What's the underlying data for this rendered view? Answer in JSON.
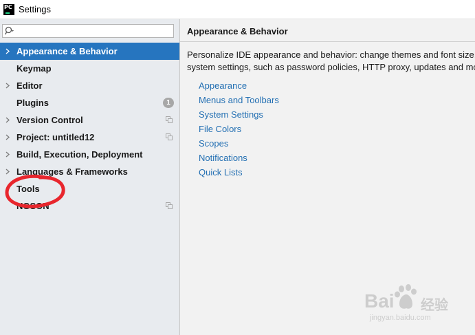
{
  "window": {
    "app_icon_text": "PC",
    "title": "Settings"
  },
  "search": {
    "value": "",
    "placeholder": ""
  },
  "sidebar": {
    "items": [
      {
        "label": "Appearance & Behavior",
        "expandable": true,
        "selected": true
      },
      {
        "label": "Keymap",
        "expandable": false
      },
      {
        "label": "Editor",
        "expandable": true
      },
      {
        "label": "Plugins",
        "expandable": false,
        "badge": "1"
      },
      {
        "label": "Version Control",
        "expandable": true,
        "copy_icon": true
      },
      {
        "label": "Project: untitled12",
        "expandable": true,
        "copy_icon": true
      },
      {
        "label": "Build, Execution, Deployment",
        "expandable": true
      },
      {
        "label": "Languages & Frameworks",
        "expandable": true
      },
      {
        "label": "Tools",
        "expandable": false
      },
      {
        "label": "NGSON",
        "expandable": false,
        "copy_icon": true
      }
    ]
  },
  "main": {
    "title": "Appearance & Behavior",
    "description_line1": "Personalize IDE appearance and behavior: change themes and font size,",
    "description_line2": "system settings, such as password policies, HTTP proxy, updates and mo",
    "links": [
      "Appearance",
      "Menus and Toolbars",
      "System Settings",
      "File Colors",
      "Scopes",
      "Notifications",
      "Quick Lists"
    ]
  },
  "watermark": {
    "brand": "Bai",
    "brand_cn": "经验",
    "url": "jingyan.baidu.com"
  },
  "colors": {
    "selection": "#2675bf",
    "link": "#2470b3",
    "annotation": "#e8262d"
  }
}
